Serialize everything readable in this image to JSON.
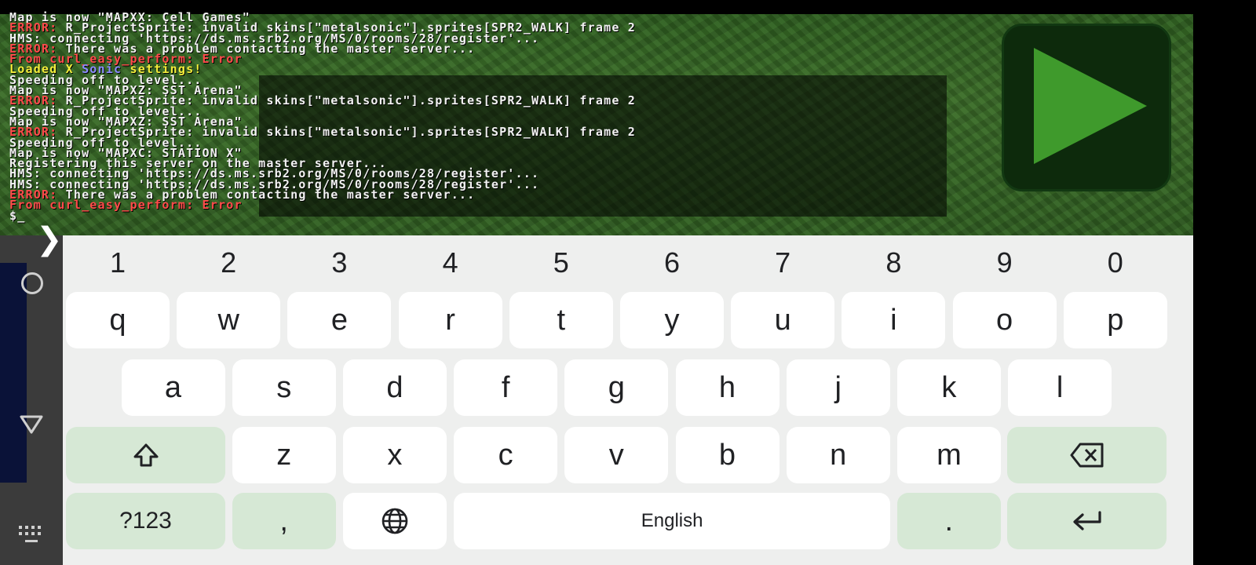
{
  "console": {
    "lines": [
      [
        {
          "t": "Map is now \"MAPXX: Cell Games\"",
          "c": ""
        }
      ],
      [
        {
          "t": "ERROR:",
          "c": "err"
        },
        {
          "t": " R_ProjectSprite: invalid skins[\"metalsonic\"].sprites[SPR2_WALK] frame 2",
          "c": ""
        }
      ],
      [
        {
          "t": "HMS: connecting 'https://ds.ms.srb2.org/MS/0/rooms/28/register'...",
          "c": ""
        }
      ],
      [
        {
          "t": "ERROR:",
          "c": "err"
        },
        {
          "t": " There was a problem contacting the master server...",
          "c": ""
        }
      ],
      [
        {
          "t": "From curl_easy_perform: Error",
          "c": "err"
        }
      ],
      [
        {
          "t": "Loaded X ",
          "c": "yellow"
        },
        {
          "t": "Sonic",
          "c": "blue"
        },
        {
          "t": " settings!",
          "c": "yellow"
        }
      ],
      [
        {
          "t": "Speeding off to level...",
          "c": ""
        }
      ],
      [
        {
          "t": "Map is now \"MAPXZ: SST Arena\"",
          "c": ""
        }
      ],
      [
        {
          "t": "ERROR:",
          "c": "err"
        },
        {
          "t": " R_ProjectSprite: invalid skins[\"metalsonic\"].sprites[SPR2_WALK] frame 2",
          "c": ""
        }
      ],
      [
        {
          "t": "Speeding off to level...",
          "c": ""
        }
      ],
      [
        {
          "t": "Map is now \"MAPXZ: SST Arena\"",
          "c": ""
        }
      ],
      [
        {
          "t": "ERROR:",
          "c": "err"
        },
        {
          "t": " R_ProjectSprite: invalid skins[\"metalsonic\"].sprites[SPR2_WALK] frame 2",
          "c": ""
        }
      ],
      [
        {
          "t": "Speeding off to level...",
          "c": ""
        }
      ],
      [
        {
          "t": "Map is now \"MAPXC: STATION X\"",
          "c": ""
        }
      ],
      [
        {
          "t": "Registering this server on the master server...",
          "c": ""
        }
      ],
      [
        {
          "t": "HMS: connecting 'https://ds.ms.srb2.org/MS/0/rooms/28/register'...",
          "c": ""
        }
      ],
      [
        {
          "t": "HMS: connecting 'https://ds.ms.srb2.org/MS/0/rooms/28/register'...",
          "c": ""
        }
      ],
      [
        {
          "t": "ERROR:",
          "c": "err"
        },
        {
          "t": " There was a problem contacting the master server...",
          "c": ""
        }
      ],
      [
        {
          "t": "From curl_easy_perform: Error",
          "c": "err"
        }
      ],
      [
        {
          "t": "$_",
          "c": ""
        }
      ]
    ]
  },
  "overlay": {
    "play_icon": "play-triangle-icon",
    "expand_icon": "chevron-right-icon"
  },
  "navigation": {
    "home_icon": "nav-home-circle-icon",
    "back_icon": "nav-back-triangle-icon",
    "keyboard_icon": "keyboard-switch-icon"
  },
  "keyboard": {
    "numbers": [
      "1",
      "2",
      "3",
      "4",
      "5",
      "6",
      "7",
      "8",
      "9",
      "0"
    ],
    "row1": [
      "q",
      "w",
      "e",
      "r",
      "t",
      "y",
      "u",
      "i",
      "o",
      "p"
    ],
    "row2": [
      "a",
      "s",
      "d",
      "f",
      "g",
      "h",
      "j",
      "k",
      "l"
    ],
    "row3": [
      "z",
      "x",
      "c",
      "v",
      "b",
      "n",
      "m"
    ],
    "symbols_label": "?123",
    "comma_label": ",",
    "space_label": "English",
    "period_label": ".",
    "shift_icon": "shift-icon",
    "backspace_icon": "backspace-icon",
    "globe_icon": "globe-icon",
    "enter_icon": "enter-icon",
    "colors": {
      "background": "#eeefee",
      "key": "#ffffff",
      "function_key": "#d6e8d5"
    }
  }
}
